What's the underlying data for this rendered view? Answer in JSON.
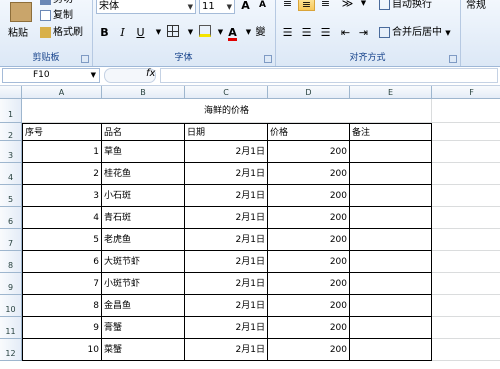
{
  "ribbon": {
    "clipboard": {
      "paste_label": "粘贴",
      "cut_label": "剪切",
      "copy_label": "复制",
      "format_painter_label": "格式刷",
      "group_label": "剪贴板"
    },
    "font": {
      "font_name": "宋体",
      "font_size": "11",
      "bold": "B",
      "italic": "I",
      "underline": "U",
      "grow": "A",
      "shrink": "A",
      "font_color_glyph": "A",
      "phonetic": "變",
      "group_label": "字体"
    },
    "alignment": {
      "wrap_label": "自动换行",
      "merge_label": "合并后居中",
      "group_label": "对齐方式"
    },
    "number": {
      "format": "常规"
    }
  },
  "formula_bar": {
    "name_box": "F10",
    "fx": "fx",
    "formula": ""
  },
  "sheet": {
    "columns": [
      "A",
      "B",
      "C",
      "D",
      "E",
      "F"
    ],
    "rows": [
      "1",
      "2",
      "3",
      "4",
      "5",
      "6",
      "7",
      "8",
      "9",
      "10",
      "11",
      "12"
    ],
    "title": "海鲜的价格",
    "headers": [
      "序号",
      "品名",
      "日期",
      "价格",
      "备注"
    ],
    "data": [
      [
        "1",
        "草鱼",
        "2月1日",
        "200",
        ""
      ],
      [
        "2",
        "桂花鱼",
        "2月1日",
        "200",
        ""
      ],
      [
        "3",
        "小石斑",
        "2月1日",
        "200",
        ""
      ],
      [
        "4",
        "青石斑",
        "2月1日",
        "200",
        ""
      ],
      [
        "5",
        "老虎鱼",
        "2月1日",
        "200",
        ""
      ],
      [
        "6",
        "大斑节虾",
        "2月1日",
        "200",
        ""
      ],
      [
        "7",
        "小斑节虾",
        "2月1日",
        "200",
        ""
      ],
      [
        "8",
        "金昌鱼",
        "2月1日",
        "200",
        ""
      ],
      [
        "9",
        "膏蟹",
        "2月1日",
        "200",
        ""
      ],
      [
        "10",
        "菜蟹",
        "2月1日",
        "200",
        ""
      ]
    ]
  },
  "colors": {
    "ribbon_text": "#15428b",
    "font_color_red": "#e00000",
    "highlight_yellow": "#f5e400"
  }
}
